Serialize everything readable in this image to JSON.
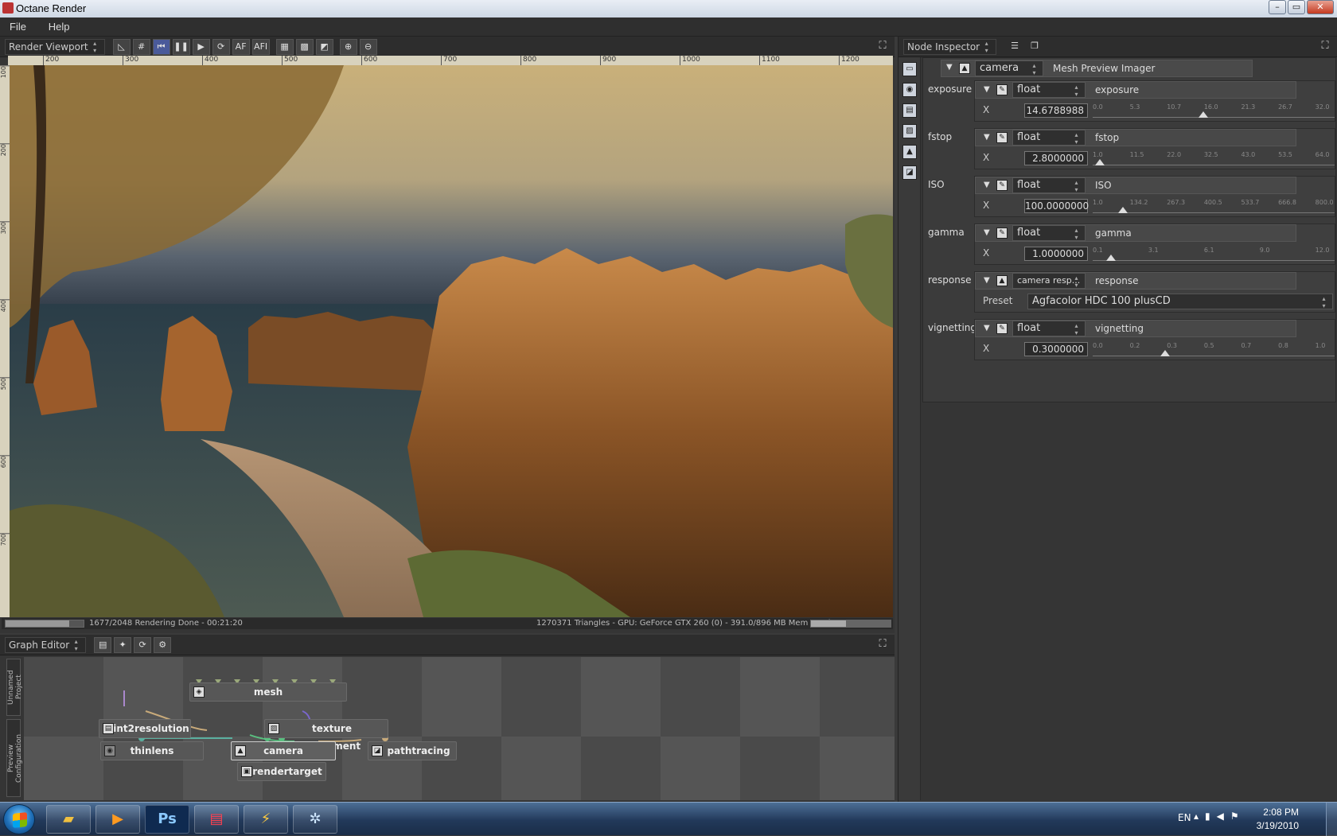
{
  "window": {
    "title": "Octane Render"
  },
  "window_buttons": {
    "minimize": "–",
    "maximize": "▭",
    "close": "✕"
  },
  "menu": [
    "File",
    "Help"
  ],
  "viewport": {
    "panel_label": "Render Viewport",
    "toolbar": [
      "pick-focus-icon",
      "grid-icon",
      "reset-icon",
      "pause-icon",
      "play-icon",
      "refresh-icon",
      "AF",
      "AFI",
      "checker-icon",
      "pattern-icon",
      "channel-icon",
      "zoom-in-icon",
      "zoom-out-icon"
    ],
    "toolbar_text": {
      "af": "AF",
      "afi": "AFI"
    },
    "ruler_h": [
      "200",
      "300",
      "400",
      "500",
      "600",
      "700",
      "800",
      "900",
      "1000",
      "1100",
      "1200"
    ],
    "ruler_v": [
      "100",
      "200",
      "300",
      "400",
      "500",
      "600",
      "700"
    ],
    "status_left": "1677/2048 Rendering Done - 00:21:20",
    "status_right": "1270371 Triangles - GPU: GeForce GTX 260 (0) - 391.0/896 MB Mem Used",
    "progress": 0.819,
    "memory": 0.436
  },
  "graph": {
    "panel_label": "Graph Editor",
    "tabs": [
      "Unnamed Project",
      "Preview Configuration"
    ],
    "nodes": [
      {
        "label": "mesh"
      },
      {
        "label": "int2resolution"
      },
      {
        "label": "texture environment"
      },
      {
        "label": "thinlens"
      },
      {
        "label": "camera"
      },
      {
        "label": "pathtracing"
      },
      {
        "label": "rendertarget"
      }
    ]
  },
  "inspector": {
    "panel_label": "Node Inspector",
    "node_name": "camera",
    "node_type": "Mesh Preview Imager",
    "params": [
      {
        "label": "exposure",
        "type": "float",
        "name": "exposure",
        "axis": "X",
        "value": "14.6788988",
        "ticks": [
          "0.0",
          "5.3",
          "10.7",
          "16.0",
          "21.3",
          "26.7",
          "32.0"
        ],
        "pos": 0.4587
      },
      {
        "label": "fstop",
        "type": "float",
        "name": "fstop",
        "axis": "X",
        "value": "2.8000000",
        "ticks": [
          "1.0",
          "11.5",
          "22.0",
          "32.5",
          "43.0",
          "53.5",
          "64.0"
        ],
        "pos": 0.0286
      },
      {
        "label": "ISO",
        "type": "float",
        "name": "ISO",
        "axis": "X",
        "value": "100.0000000",
        "ticks": [
          "1.0",
          "134.2",
          "267.3",
          "400.5",
          "533.7",
          "666.8",
          "800.0"
        ],
        "pos": 0.1239
      },
      {
        "label": "gamma",
        "type": "float",
        "name": "gamma",
        "axis": "X",
        "value": "1.0000000",
        "ticks": [
          "0.1",
          "3.1",
          "6.1",
          "9.0",
          "12.0"
        ],
        "pos": 0.0756
      },
      {
        "label": "response",
        "type": "camera resp...",
        "name": "response",
        "axis": "Preset",
        "value": "Agfacolor HDC 100 plusCD",
        "ticks": [],
        "pos": null
      },
      {
        "label": "vignetting",
        "type": "float",
        "name": "vignetting",
        "axis": "X",
        "value": "0.3000000",
        "ticks": [
          "0.0",
          "0.2",
          "0.3",
          "0.5",
          "0.7",
          "0.8",
          "1.0"
        ],
        "pos": 0.3
      }
    ]
  },
  "taskbar": {
    "apps": [
      "explorer-icon",
      "media-player-icon",
      "Ps",
      "save-icon",
      "octane-icon",
      "settings-icon"
    ],
    "ps_label": "Ps",
    "lang": "EN",
    "time": "2:08 PM",
    "date": "3/19/2010"
  }
}
